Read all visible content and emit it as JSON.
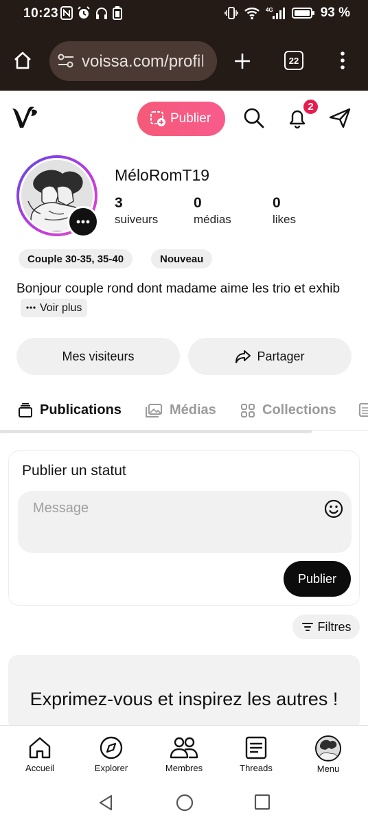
{
  "status_bar": {
    "time": "10:23",
    "battery_percent": "93 %",
    "network": "4G"
  },
  "browser": {
    "url": "voissa.com/profil",
    "tab_count": "22"
  },
  "header": {
    "publish_label": "Publier",
    "notification_count": "2"
  },
  "profile": {
    "username": "MéloRomT19",
    "stats": [
      {
        "value": "3",
        "label": "suiveurs"
      },
      {
        "value": "0",
        "label": "médias"
      },
      {
        "value": "0",
        "label": "likes"
      }
    ],
    "tags": [
      "Couple 30-35, 35-40",
      "Nouveau"
    ],
    "bio": "Bonjour couple rond dont madame aime les trio et exhib",
    "see_more_label": "Voir plus"
  },
  "actions": {
    "visitors_label": "Mes visiteurs",
    "share_label": "Partager"
  },
  "tabs": [
    {
      "label": "Publications",
      "active": true
    },
    {
      "label": "Médias",
      "active": false
    },
    {
      "label": "Collections",
      "active": false
    }
  ],
  "composer": {
    "title": "Publier un statut",
    "placeholder": "Message",
    "submit_label": "Publier"
  },
  "filters_label": "Filtres",
  "empty_state": {
    "title": "Exprimez-vous et inspirez les autres !"
  },
  "bottom_nav": [
    {
      "label": "Accueil",
      "icon": "home-icon"
    },
    {
      "label": "Explorer",
      "icon": "compass-icon"
    },
    {
      "label": "Membres",
      "icon": "members-icon"
    },
    {
      "label": "Threads",
      "icon": "threads-icon"
    },
    {
      "label": "Menu",
      "icon": "avatar"
    }
  ],
  "colors": {
    "accent": "#f65a78",
    "badge": "#e81d4f",
    "dark_chrome": "#241b17"
  }
}
